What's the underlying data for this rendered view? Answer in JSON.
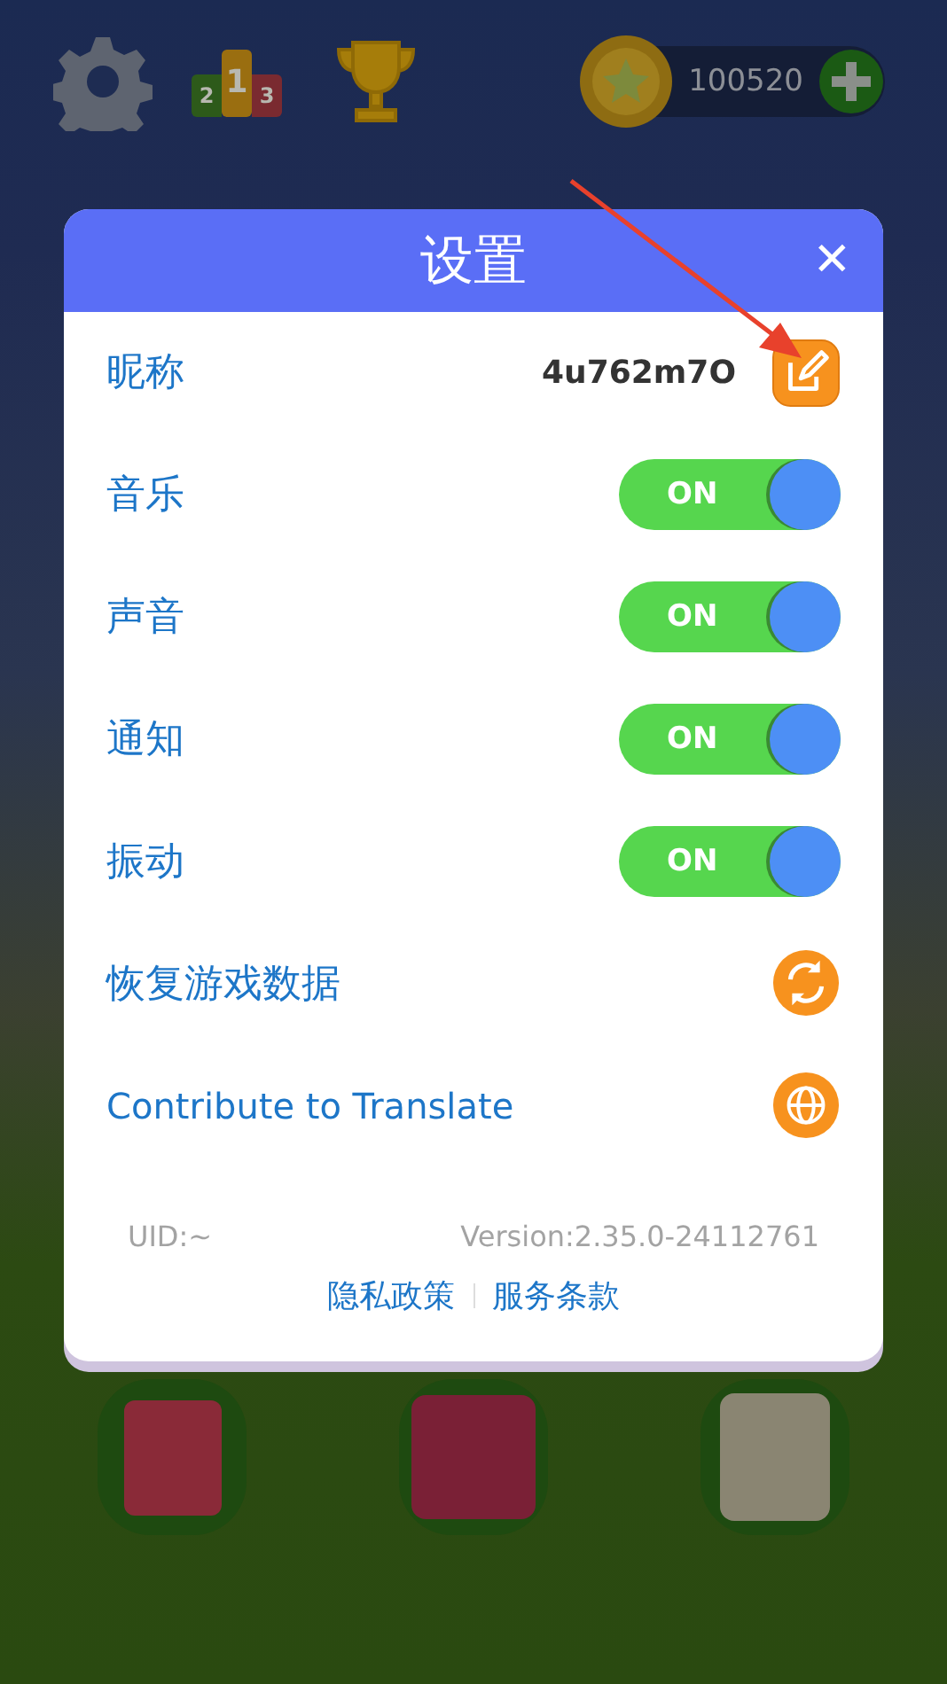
{
  "top_bar": {
    "podium_ranks": [
      "2",
      "1",
      "3"
    ],
    "coins": "100520"
  },
  "dialog": {
    "title": "设置",
    "close": "✕",
    "rows": [
      {
        "kind": "nickname",
        "label": "昵称",
        "value": "4u762m7O"
      },
      {
        "kind": "toggle",
        "label": "音乐",
        "on": true,
        "state_text": "ON"
      },
      {
        "kind": "toggle",
        "label": "声音",
        "on": true,
        "state_text": "ON"
      },
      {
        "kind": "toggle",
        "label": "通知",
        "on": true,
        "state_text": "ON"
      },
      {
        "kind": "toggle",
        "label": "振动",
        "on": true,
        "state_text": "ON"
      },
      {
        "kind": "restore",
        "label": "恢复游戏数据"
      },
      {
        "kind": "translate",
        "label": "Contribute to Translate"
      }
    ],
    "uid": "UID:~",
    "version": "Version:2.35.0-24112761",
    "links": [
      "隐私政策",
      "服务条款"
    ]
  }
}
